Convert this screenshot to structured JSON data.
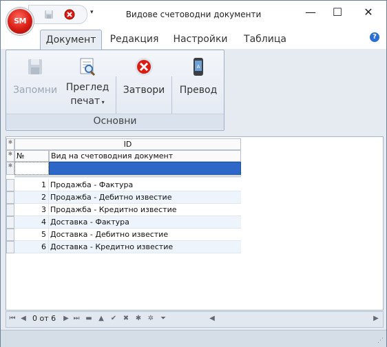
{
  "window": {
    "title": "Видове счетоводни документи",
    "app_logo_text": "SM"
  },
  "quick_access": {
    "dropdown_glyph": "▾"
  },
  "controls": {
    "minimize": "—",
    "maximize": "☐",
    "close": "✕"
  },
  "tabs": [
    {
      "label": "Документ",
      "active": true
    },
    {
      "label": "Редакция",
      "active": false
    },
    {
      "label": "Настройки",
      "active": false
    },
    {
      "label": "Таблица",
      "active": false
    }
  ],
  "help_glyph": "?",
  "ribbon": {
    "buttons": [
      {
        "label": "Запомни",
        "icon": "save-icon",
        "enabled": false
      },
      {
        "label_line1": "Преглед",
        "label_line2": "печат",
        "icon": "print-preview-icon",
        "enabled": true
      },
      {
        "label": "Затвори",
        "icon": "close-circle-icon",
        "enabled": true
      },
      {
        "label": "Превод",
        "icon": "phone-translate-icon",
        "enabled": true
      }
    ],
    "group_label": "Основни"
  },
  "grid": {
    "band_header": "ID",
    "columns": [
      "№",
      "Вид на счетоводния документ"
    ],
    "rows": [
      {
        "num": "1",
        "name": "Продажба - Фактура"
      },
      {
        "num": "2",
        "name": "Продажба - Дебитно известие"
      },
      {
        "num": "3",
        "name": "Продажба - Кредитно известие"
      },
      {
        "num": "4",
        "name": "Доставка - Фактура"
      },
      {
        "num": "5",
        "name": "Доставка - Дебитно известие"
      },
      {
        "num": "6",
        "name": "Доставка - Кредитно известие"
      }
    ]
  },
  "navigator": {
    "record_text": "0 от 6"
  },
  "colors": {
    "accent": "#2d68c8",
    "close_red": "#d91d14"
  }
}
